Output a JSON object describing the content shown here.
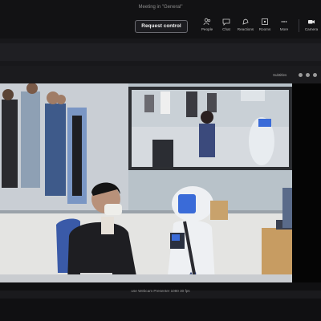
{
  "window": {
    "title": "Meeting in \"General\""
  },
  "toolbar": {
    "request_control_label": "Request control",
    "items": [
      {
        "label": "People",
        "icon": "people-icon"
      },
      {
        "label": "Chat",
        "icon": "chat-icon"
      },
      {
        "label": "Reactions",
        "icon": "reactions-icon"
      },
      {
        "label": "Rooms",
        "icon": "rooms-icon"
      },
      {
        "label": "More",
        "icon": "more-icon"
      },
      {
        "label": "Camera",
        "icon": "camera-icon"
      }
    ]
  },
  "video_header": {
    "subtitle": "Subtitles"
  },
  "footer": {
    "caption": "use Webcam Presenter 1080 30 fps"
  },
  "colors": {
    "background": "#0c0c0e",
    "button_border": "#6a6a70",
    "robot_white": "#eef0f3",
    "robot_screen": "#3a6bd8"
  }
}
